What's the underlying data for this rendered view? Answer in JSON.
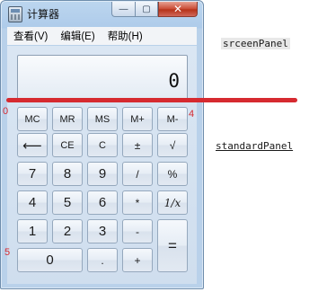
{
  "window": {
    "title": "计算器",
    "caption": {
      "minimize": "—",
      "maximize": "▢",
      "close": "✕"
    }
  },
  "menu": [
    "查看(V)",
    "编辑(E)",
    "帮助(H)"
  ],
  "display": {
    "value": "0"
  },
  "buttons": {
    "mc": "MC",
    "mr": "MR",
    "ms": "MS",
    "mplus": "M+",
    "mminus": "M-",
    "backspace": "⟵",
    "ce": "CE",
    "c": "C",
    "plusminus": "±",
    "sqrt": "√",
    "n7": "7",
    "n8": "8",
    "n9": "9",
    "divide": "/",
    "percent": "%",
    "n4": "4",
    "n5": "5",
    "n6": "6",
    "multiply": "*",
    "reciprocal": "1/x",
    "n1": "1",
    "n2": "2",
    "n3": "3",
    "minus": "-",
    "equals": "=",
    "n0": "0",
    "decimal": ".",
    "plus": "+"
  },
  "annotations": {
    "screen_panel": "srceenPanel",
    "standard_panel": "standardPanel",
    "marks": {
      "left_top": "0",
      "right_top": "4",
      "left_bottom": "5"
    }
  },
  "colors": {
    "annotation_line": "#d62a30",
    "window_frame": "#aecbea"
  }
}
